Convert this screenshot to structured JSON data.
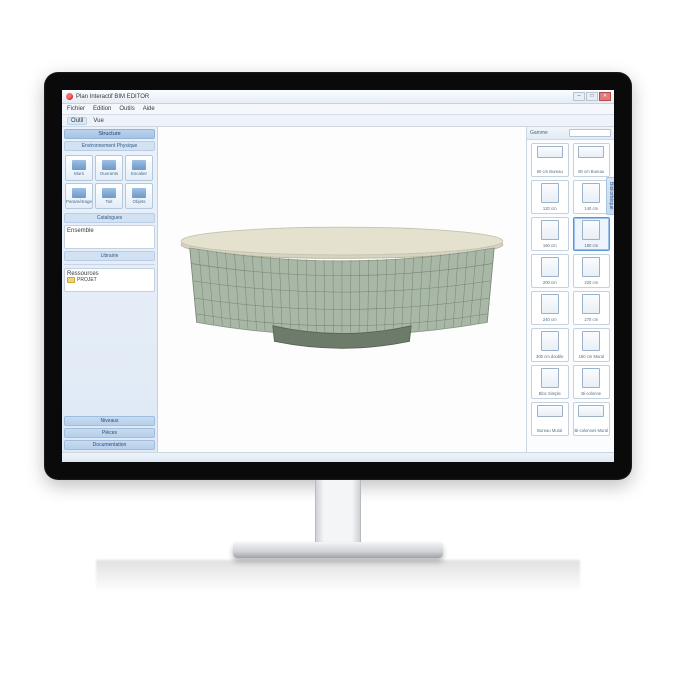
{
  "app": {
    "title": "Plan Interactif BIM EDITOR",
    "device": "desktop-monitor"
  },
  "window_controls": {
    "minimize": "–",
    "maximize": "□",
    "close": "✕"
  },
  "menu": [
    "Fichier",
    "Edition",
    "Outils",
    "Aide"
  ],
  "tooltabs": {
    "items": [
      "Outil",
      "Vue"
    ],
    "active": 0
  },
  "left_panel": {
    "section_top": "Environnement",
    "group_structure": "Structure",
    "group_effects": "Environnement Physique",
    "tool_buttons": [
      {
        "label": "Murs"
      },
      {
        "label": "Ouvrants"
      },
      {
        "label": "Escalier"
      },
      {
        "label": "Paramétrage"
      },
      {
        "label": "Toit"
      },
      {
        "label": "Objets"
      }
    ],
    "group_catalogs": "Catalogues",
    "catalogs_list_label": "Ensemble",
    "group_library": "Librairie",
    "project_tree_label": "Ressources",
    "project_tree_folder": "PROJET",
    "bottom_bars": [
      "Niveaux",
      "Pièces",
      "Documentation"
    ]
  },
  "canvas": {
    "model_description": "Curved curtain-wall glass facade building with flat overhanging roof"
  },
  "right_panel": {
    "dropdown_label": "Gamme",
    "side_tab": "Bibliothèque",
    "items": [
      {
        "label": "60 cm Bureau",
        "selected": false,
        "shape": "wide"
      },
      {
        "label": "80 cm Bureau",
        "selected": false,
        "shape": "wide"
      },
      {
        "label": "120 cm",
        "selected": false,
        "shape": "tall"
      },
      {
        "label": "140 cm",
        "selected": false,
        "shape": "tall"
      },
      {
        "label": "160 cm",
        "selected": false,
        "shape": "tall"
      },
      {
        "label": "180 cm",
        "selected": true,
        "shape": "tall"
      },
      {
        "label": "200 cm",
        "selected": false,
        "shape": "tall"
      },
      {
        "label": "220 cm",
        "selected": false,
        "shape": "tall"
      },
      {
        "label": "240 cm",
        "selected": false,
        "shape": "tall"
      },
      {
        "label": "270 cm",
        "selected": false,
        "shape": "tall"
      },
      {
        "label": "300 cm double",
        "selected": false,
        "shape": "tall"
      },
      {
        "label": "180 cm Mural",
        "selected": false,
        "shape": "tall"
      },
      {
        "label": "Bloc Simple",
        "selected": false,
        "shape": "tall"
      },
      {
        "label": "Bi-colonne",
        "selected": false,
        "shape": "tall"
      },
      {
        "label": "Bureau Mural",
        "selected": false,
        "shape": "wide"
      },
      {
        "label": "Bi-colonnes Mural",
        "selected": false,
        "shape": "wide"
      }
    ]
  }
}
